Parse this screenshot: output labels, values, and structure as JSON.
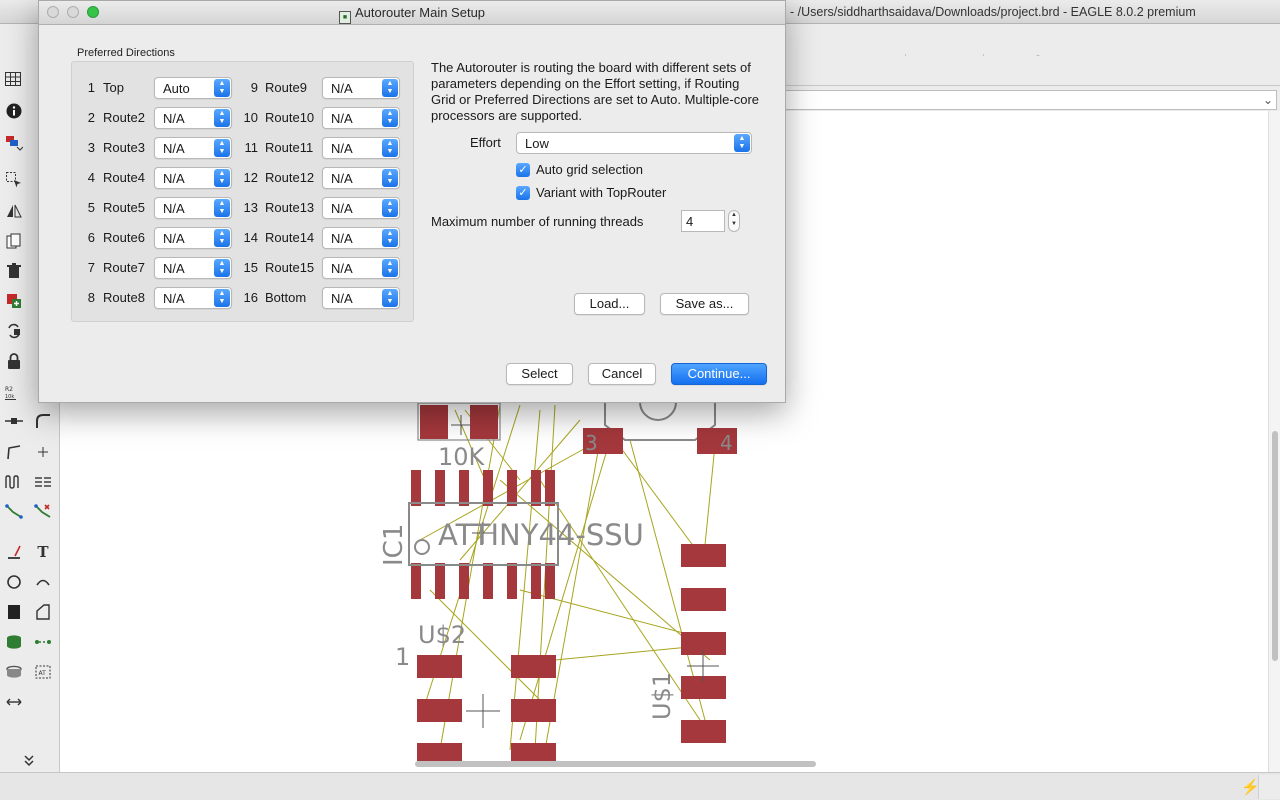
{
  "main_window": {
    "title": "- /Users/siddharthsaidava/Downloads/project.brd - EAGLE 8.0.2 premium"
  },
  "dialog": {
    "title": "Autorouter Main Setup",
    "preferred_directions_label": "Preferred Directions",
    "directions": [
      {
        "num": "1",
        "name": "Top",
        "value": "Auto"
      },
      {
        "num": "2",
        "name": "Route2",
        "value": "N/A"
      },
      {
        "num": "3",
        "name": "Route3",
        "value": "N/A"
      },
      {
        "num": "4",
        "name": "Route4",
        "value": "N/A"
      },
      {
        "num": "5",
        "name": "Route5",
        "value": "N/A"
      },
      {
        "num": "6",
        "name": "Route6",
        "value": "N/A"
      },
      {
        "num": "7",
        "name": "Route7",
        "value": "N/A"
      },
      {
        "num": "8",
        "name": "Route8",
        "value": "N/A"
      },
      {
        "num": "9",
        "name": "Route9",
        "value": "N/A"
      },
      {
        "num": "10",
        "name": "Route10",
        "value": "N/A"
      },
      {
        "num": "11",
        "name": "Route11",
        "value": "N/A"
      },
      {
        "num": "12",
        "name": "Route12",
        "value": "N/A"
      },
      {
        "num": "13",
        "name": "Route13",
        "value": "N/A"
      },
      {
        "num": "14",
        "name": "Route14",
        "value": "N/A"
      },
      {
        "num": "15",
        "name": "Route15",
        "value": "N/A"
      },
      {
        "num": "16",
        "name": "Bottom",
        "value": "N/A"
      }
    ],
    "description": "The Autorouter is routing the board with different sets of parameters depending on the Effort setting, if Routing Grid or Preferred Directions are set to Auto. Multiple-core processors are supported.",
    "effort_label": "Effort",
    "effort_value": "Low",
    "auto_grid_label": "Auto grid selection",
    "auto_grid_checked": true,
    "variant_label": "Variant with TopRouter",
    "variant_checked": true,
    "threads_label": "Maximum number of running threads",
    "threads_value": "4",
    "load_label": "Load...",
    "save_as_label": "Save as...",
    "select_label": "Select",
    "cancel_label": "Cancel",
    "continue_label": "Continue..."
  },
  "board": {
    "labels": {
      "resistor_value": "10K",
      "ic_name": "IC1",
      "ic_value": "ATTINY44-SSU",
      "u2_name": "U$2",
      "u2_pin": "1",
      "u1_name": "U$1"
    }
  },
  "colors": {
    "pad": "#a4383c",
    "airwire": "#a7a41e",
    "silkscreen": "#8a8a8a",
    "accent": "#1a73e8"
  }
}
